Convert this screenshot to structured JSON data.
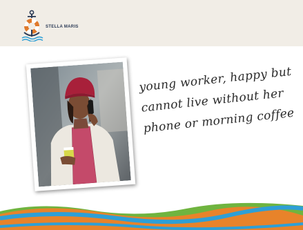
{
  "brand": {
    "name": "STELLA MARIS"
  },
  "caption": {
    "line1": "young worker, happy but",
    "line2": "cannot live without her",
    "line3": "phone or morning coffee"
  },
  "colors": {
    "header_bg": "#f1ede6",
    "logo_orange": "#e07a2c",
    "logo_navy": "#2b3a55",
    "logo_blue": "#2e9fd6",
    "wave_orange": "#e8832a",
    "wave_blue": "#2e9fd6",
    "wave_green": "#6fb43f"
  },
  "icons": {
    "logo": "anchor-lifebuoy-icon"
  }
}
